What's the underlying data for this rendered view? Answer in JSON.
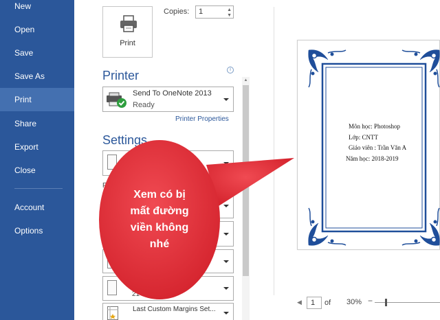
{
  "nav": {
    "items": [
      {
        "label": "New"
      },
      {
        "label": "Open"
      },
      {
        "label": "Save"
      },
      {
        "label": "Save As"
      },
      {
        "label": "Print",
        "active": true
      },
      {
        "label": "Share"
      },
      {
        "label": "Export"
      },
      {
        "label": "Close"
      },
      {
        "label": "Account"
      },
      {
        "label": "Options"
      }
    ],
    "bg_color": "#2b579a"
  },
  "print": {
    "button_label": "Print",
    "copies_label": "Copies:",
    "copies_value": "1"
  },
  "printer": {
    "title": "Printer",
    "name": "Send To OneNote 2013",
    "status": "Ready",
    "properties_link": "Printer Properties",
    "info_icon": "info-icon"
  },
  "settings": {
    "title": "Settings",
    "partial_label": "P",
    "partial_size": "21",
    "margins_label": "Last Custom Margins Set..."
  },
  "preview": {
    "lines": [
      "Môn học: Photoshop",
      "Lớp: CNTT",
      "Giáo viên : Trần Văn A",
      "Năm học: 2018-2019"
    ],
    "border_color": "#1f4e9a"
  },
  "page_nav": {
    "current_page": "1",
    "of_label": "of",
    "zoom": "30%",
    "zoom_minus": "−"
  },
  "callout": {
    "text_lines": [
      "Xem có bị",
      "mất đường",
      "viền không",
      "nhé"
    ],
    "color": "#e8323c"
  }
}
